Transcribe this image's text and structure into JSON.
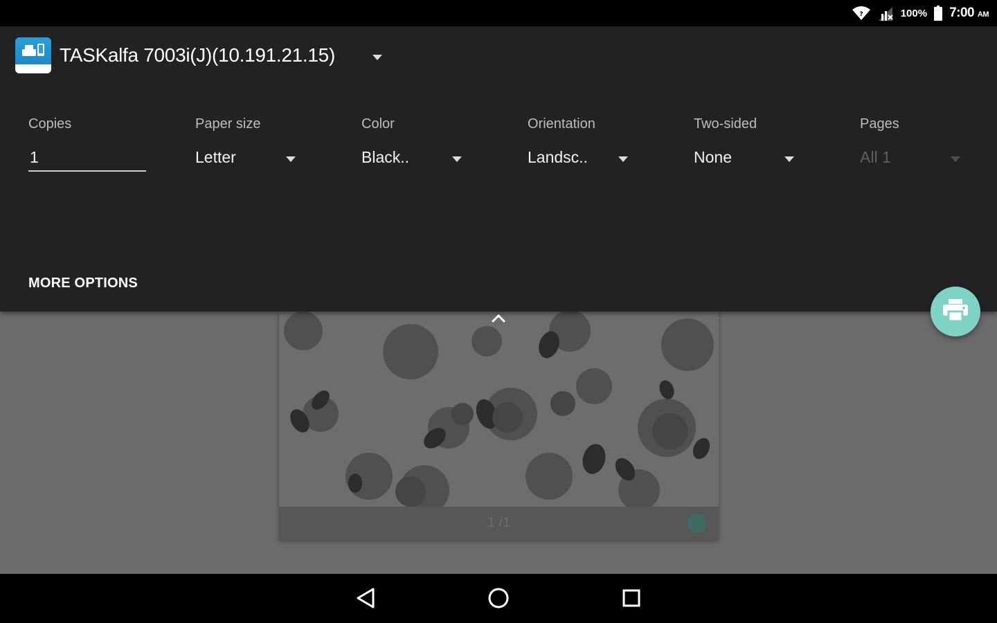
{
  "status_bar": {
    "wifi_icon": "wifi-icon",
    "signal_icon": "signal-no-sim-icon",
    "battery_percent": "100%",
    "battery_icon": "battery-full-icon",
    "time": "7:00",
    "ampm": "AM"
  },
  "printer": {
    "name": "TASKalfa 7003i(J)(10.191.21.15)",
    "logo_icon": "print-service-app-icon",
    "dropdown_icon": "caret-down-icon"
  },
  "options": {
    "copies": {
      "label": "Copies",
      "value": "1"
    },
    "paper_size": {
      "label": "Paper size",
      "value": "Letter"
    },
    "color": {
      "label": "Color",
      "value": "Black.."
    },
    "orientation": {
      "label": "Orientation",
      "value": "Landsc.."
    },
    "two_sided": {
      "label": "Two-sided",
      "value": "None"
    },
    "pages": {
      "label": "Pages",
      "value": "All 1"
    }
  },
  "more_options_label": "MORE OPTIONS",
  "collapse_icon": "chevron-up-icon",
  "print_fab_icon": "printer-icon",
  "preview": {
    "page_indicator": "1 /1"
  },
  "nav": {
    "back_icon": "back-triangle-icon",
    "home_icon": "home-circle-icon",
    "recents_icon": "recents-square-icon"
  },
  "colors": {
    "panel_bg": "#222222",
    "fab": "#7fd3c6",
    "scrim": "#6b6b6b"
  }
}
